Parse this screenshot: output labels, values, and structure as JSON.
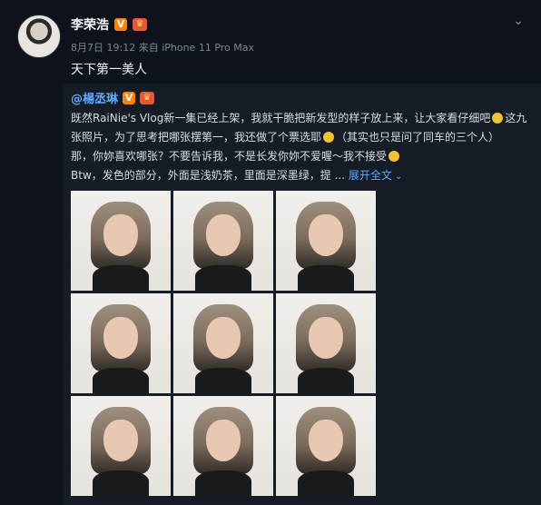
{
  "post": {
    "author": "李荣浩",
    "time": "8月7日 19:12",
    "source": "来自 iPhone 11 Pro Max",
    "text": "天下第一美人"
  },
  "repost": {
    "author": "@楊丞琳",
    "lines": [
      "既然RaiNie's Vlog新一集已经上架，我就干脆把新发型的样子放上来，让大家看仔细吧",
      "这九",
      "张照片，为了思考把哪张摆第一，我还做了个票选耶",
      "（其实也只是问了同车的三个人）",
      "那，你妳喜欢哪张？不要告诉我，不是长发你妳不爱喔～我不接受",
      "Btw，发色的部分，外面是浅奶茶，里面是深墨绿，提 ... "
    ],
    "expand_label": "展开全文",
    "photo_count": 9
  },
  "icons": [
    "verified-v-icon",
    "crown-badge-icon",
    "chevron-down-icon",
    "emoji-icon",
    "expand-arrow-icon"
  ],
  "colors": {
    "background": "#0e131b",
    "repost_bg": "#151c26",
    "link": "#5fa8ff",
    "verified": "#ff8200"
  }
}
